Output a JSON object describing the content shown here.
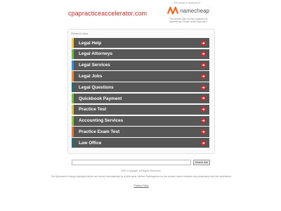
{
  "header": {
    "domain": "cpapracticeaccelerator.com",
    "registered_note": "This domain is registered at",
    "registrar": "namecheap",
    "registrar_msg": "This domain was recently registered at Namecheap. Please check back later!"
  },
  "links": {
    "header": "Related Links",
    "items": [
      {
        "label": "Legal Help",
        "accent": "#f2c94c"
      },
      {
        "label": "Legal Attorneys",
        "accent": "#6cc04a"
      },
      {
        "label": "Legal Services",
        "accent": "#3a8fd6"
      },
      {
        "label": "Legal Jobs",
        "accent": "#e8883a"
      },
      {
        "label": "Legal Questions",
        "accent": "#2c6b74"
      },
      {
        "label": "Quickbook Payment",
        "accent": "#7bc043"
      },
      {
        "label": "Practice Test",
        "accent": "#d4c84a"
      },
      {
        "label": "Accounting Services",
        "accent": "#8cc63f"
      },
      {
        "label": "Practice Exam Test",
        "accent": "#e2773b"
      },
      {
        "label": "Law Office",
        "accent": "#2c6b74"
      }
    ],
    "arrow_color": "#d9262a",
    "bar_color": "#575757"
  },
  "search": {
    "placeholder": "",
    "button_label": "Search Ads"
  },
  "footer": {
    "copyright": "2020 Copyright. All Rights Reserved.",
    "disclaimer": "The Sponsored Listings displayed above are served automatically by a third party. Neither Parkingcrew nor the domain owner maintain any relationship with the advertisers.",
    "privacy_label": "Privacy Policy"
  },
  "colors": {
    "domain_title": "#d12a2a",
    "namecheap_orange": "#f26522"
  }
}
